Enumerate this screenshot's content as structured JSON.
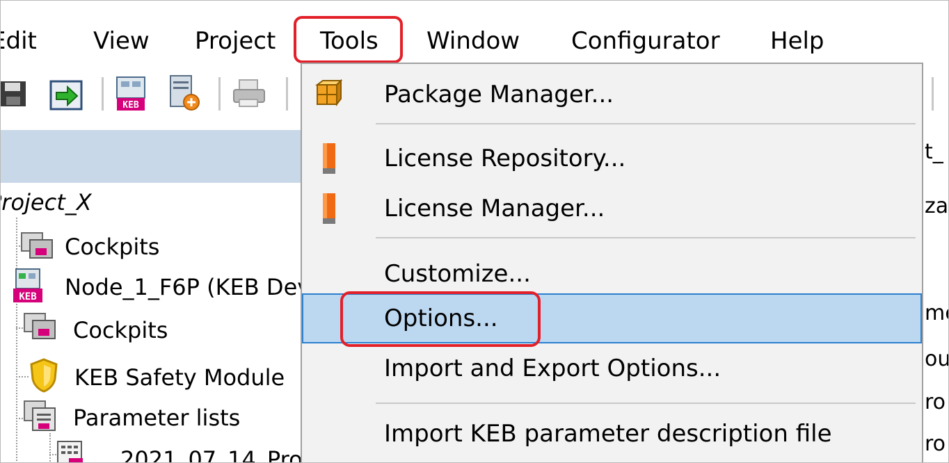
{
  "menubar": {
    "items": [
      "Edit",
      "View",
      "Project",
      "Tools",
      "Window",
      "Configurator",
      "Help"
    ]
  },
  "tree": {
    "project": "Project_X",
    "items": [
      "Cockpits",
      "Node_1_F6P (KEB Dev",
      "Cockpits",
      "KEB Safety Module",
      "Parameter lists",
      "2021_07_14_Pro"
    ]
  },
  "right_fragments": [
    "t_",
    "za",
    "me",
    "ou",
    "ro",
    "ro"
  ],
  "tools_menu": {
    "items": [
      {
        "label": "Package Manager...",
        "icon": "package-icon"
      },
      {
        "label": "License Repository...",
        "icon": "license-icon"
      },
      {
        "label": "License Manager...",
        "icon": "license-icon"
      },
      {
        "label": "Customize...",
        "icon": ""
      },
      {
        "label": "Options...",
        "icon": "",
        "selected": true
      },
      {
        "label": "Import and Export Options...",
        "icon": ""
      },
      {
        "label": "Import KEB parameter description file",
        "icon": ""
      }
    ]
  },
  "colors": {
    "highlight_red": "#e2202a",
    "selected_bg": "#bcd7f0",
    "selected_border": "#2b7fd0",
    "pane_header": "#c9d8e8"
  }
}
